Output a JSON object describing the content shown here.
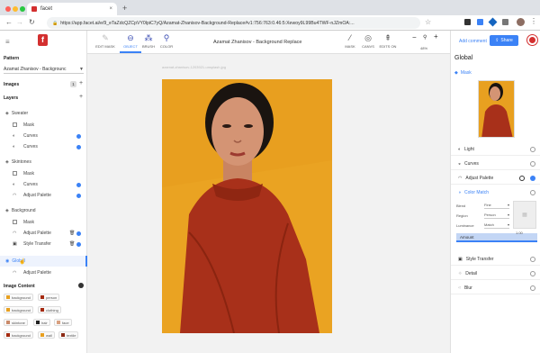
{
  "browser": {
    "tab_title": "facet",
    "url": "https://app.facet.ai/e/9_eTaZdcQZCpVY0lpiC7yQ/Azamat-Zhanisov-Background-Replace#v1:756:763:0.46:5:Xewoy9L99Bu4TWF-nJZmOA:...",
    "new_tab": "+"
  },
  "sidebar": {
    "pattern_title": "Pattern",
    "pattern_value": "Azamat Zhanisov - Backgrounc",
    "images_title": "Images",
    "images_count": "1",
    "layers_title": "Layers",
    "groups": [
      {
        "name": "Sweater",
        "items": [
          "Mask",
          "Curves",
          "Curves"
        ]
      },
      {
        "name": "Skintones",
        "items": [
          "Mask",
          "Curves",
          "Adjust Palette"
        ]
      },
      {
        "name": "Background",
        "items": [
          "Mask",
          "Adjust Palette",
          "Style Transfer"
        ]
      },
      {
        "name": "Global",
        "items": [
          "Adjust Palette"
        ]
      }
    ],
    "image_content_title": "Image Content",
    "chips": [
      "background",
      "person",
      "background",
      "clothing",
      "skintone",
      "hair",
      "face",
      "background",
      "wall",
      "textile"
    ]
  },
  "toolbar": {
    "edit_mask": "EDIT MASK",
    "object": "OBJECT",
    "brush": "BRUSH",
    "color": "COLOR",
    "doc_title": "Azamat Zhanisov - Background Replace",
    "mask": "MASK",
    "canvas": "CANVS",
    "edits_on": "EDITS ON",
    "zoom": "48%",
    "zoom_minus": "−",
    "zoom_plus": "+"
  },
  "canvas": {
    "image_caption": "azamat-zhanisov-1203921-unsplash.jpg"
  },
  "right_panel": {
    "add_comment": "Add comment",
    "share": "Share",
    "title": "Global",
    "mask_label": "Mask",
    "layers": [
      "Light",
      "Curves",
      "Adjust Palette",
      "Color Match"
    ],
    "blend_label": "Blend",
    "blend_value": "Fine",
    "region_label": "Region",
    "region_value": "Person",
    "luminance_label": "Luminance",
    "luminance_value": "Match",
    "amount_label": "Amount",
    "amount_value": "1.00",
    "amount_level": 1.0,
    "more_layers": [
      "Style Transfer",
      "Detail",
      "Blur"
    ]
  },
  "colors": {
    "accent": "#3b82f6",
    "brand": "#d32f2f",
    "photo_bg": "#e8a020",
    "sweater": "#a52a10"
  }
}
